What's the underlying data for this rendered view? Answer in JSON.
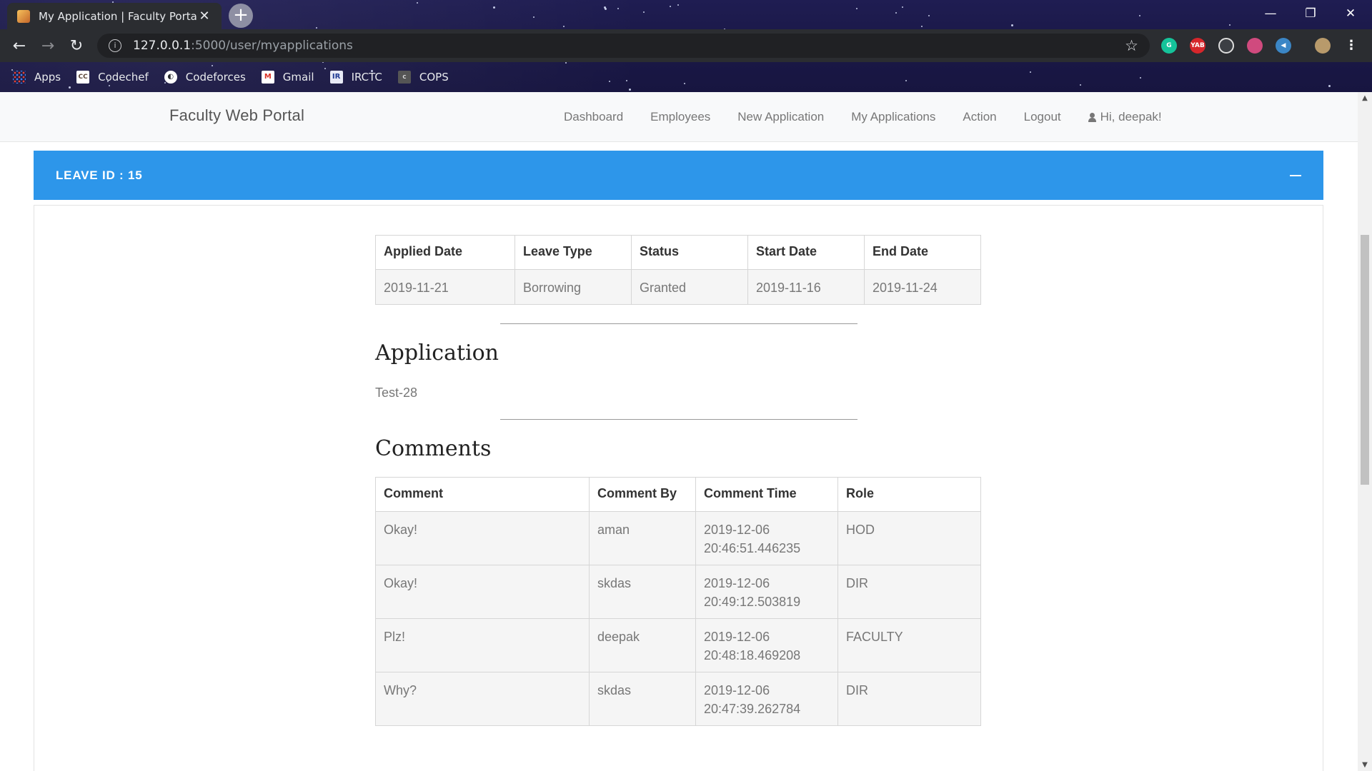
{
  "browser": {
    "tab_title": "My Application | Faculty Portal",
    "url_host": "127.0.0.1",
    "url_path": ":5000/user/myapplications",
    "bookmarks": [
      {
        "label": "Apps",
        "icon": "apps-grid-icon"
      },
      {
        "label": "Codechef",
        "icon": "codechef-icon"
      },
      {
        "label": "Codeforces",
        "icon": "codeforces-icon"
      },
      {
        "label": "Gmail",
        "icon": "gmail-icon"
      },
      {
        "label": "IRCTC",
        "icon": "irctc-icon"
      },
      {
        "label": "COPS",
        "icon": "cops-icon"
      }
    ]
  },
  "navbar": {
    "brand": "Faculty Web Portal",
    "links": [
      "Dashboard",
      "Employees",
      "New Application",
      "My Applications",
      "Action",
      "Logout"
    ],
    "greeting": "Hi, deepak!"
  },
  "panel": {
    "header": "LEAVE ID : 15",
    "accent": "#2d96ea"
  },
  "leave_table": {
    "headers": [
      "Applied Date",
      "Leave Type",
      "Status",
      "Start Date",
      "End Date"
    ],
    "row": [
      "2019-11-21",
      "Borrowing",
      "Granted",
      "2019-11-16",
      "2019-11-24"
    ]
  },
  "application": {
    "heading": "Application",
    "text": "Test-28"
  },
  "comments": {
    "heading": "Comments",
    "headers": [
      "Comment",
      "Comment By",
      "Comment Time",
      "Role"
    ],
    "rows": [
      [
        "Okay!",
        "aman",
        "2019-12-06 20:46:51.446235",
        "HOD"
      ],
      [
        "Okay!",
        "skdas",
        "2019-12-06 20:49:12.503819",
        "DIR"
      ],
      [
        "Plz!",
        "deepak",
        "2019-12-06 20:48:18.469208",
        "FACULTY"
      ],
      [
        "Why?",
        "skdas",
        "2019-12-06 20:47:39.262784",
        "DIR"
      ]
    ]
  }
}
